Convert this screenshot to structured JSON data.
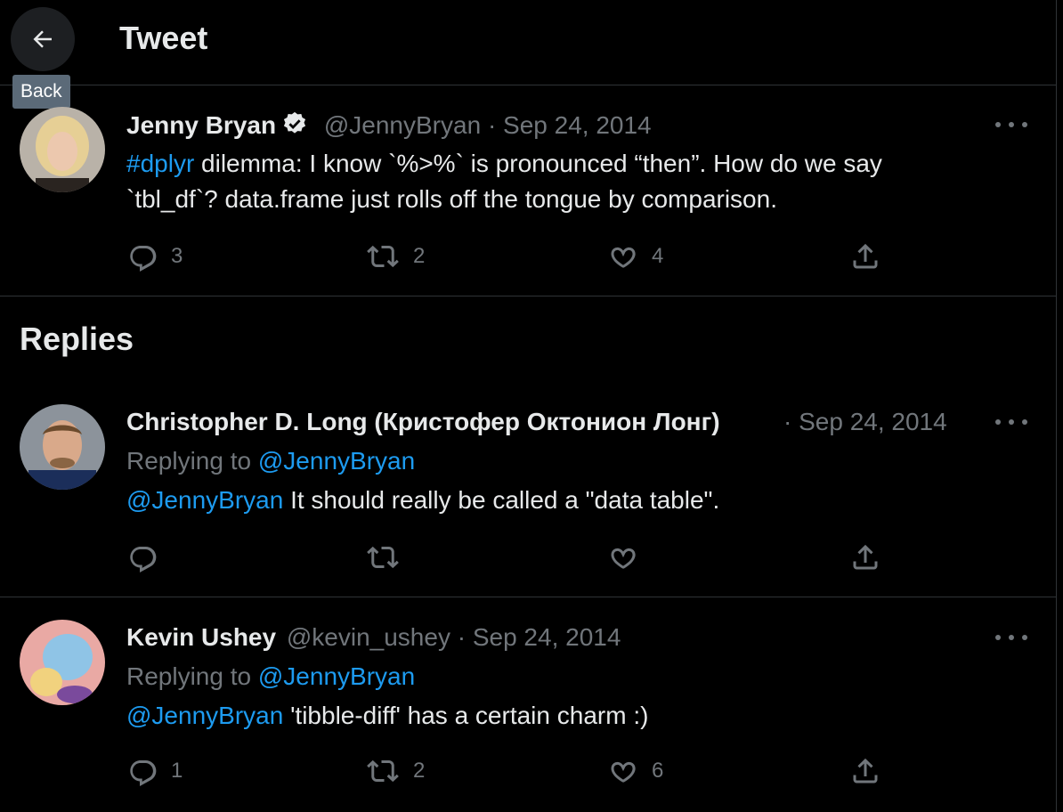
{
  "header": {
    "title": "Tweet",
    "back_tooltip": "Back"
  },
  "main_tweet": {
    "name": "Jenny Bryan",
    "handle": "@JennyBryan",
    "date": "· Sep 24, 2014",
    "hashtag": "#dplyr",
    "text_line1": " dilemma: I know `%>%` is pronounced “then”. How do we say",
    "text_line2": "`tbl_df`? data.frame just rolls off the tongue by comparison.",
    "replies": "3",
    "retweets": "2",
    "likes": "4"
  },
  "replies_heading": "Replies",
  "replies": [
    {
      "name": "Christopher D. Long (Кристофер Октонион Лонг)",
      "date": "· Sep 24, 2014",
      "replying_prefix": "Replying to ",
      "replying_to": "@JennyBryan",
      "mention": "@JennyBryan",
      "text": " It should really be called a \"data table\".",
      "replies": "",
      "retweets": "",
      "likes": ""
    },
    {
      "name": "Kevin Ushey",
      "handle": "@kevin_ushey",
      "date": "· Sep 24, 2014",
      "replying_prefix": "Replying to ",
      "replying_to": "@JennyBryan",
      "mention": "@JennyBryan",
      "text": " 'tibble-diff' has a certain charm :)",
      "replies": "1",
      "retweets": "2",
      "likes": "6"
    }
  ],
  "colors": {
    "background": "#000000",
    "link": "#1d9bf0",
    "muted": "#71767b",
    "text": "#e7e9ea",
    "border": "#2f3336"
  }
}
